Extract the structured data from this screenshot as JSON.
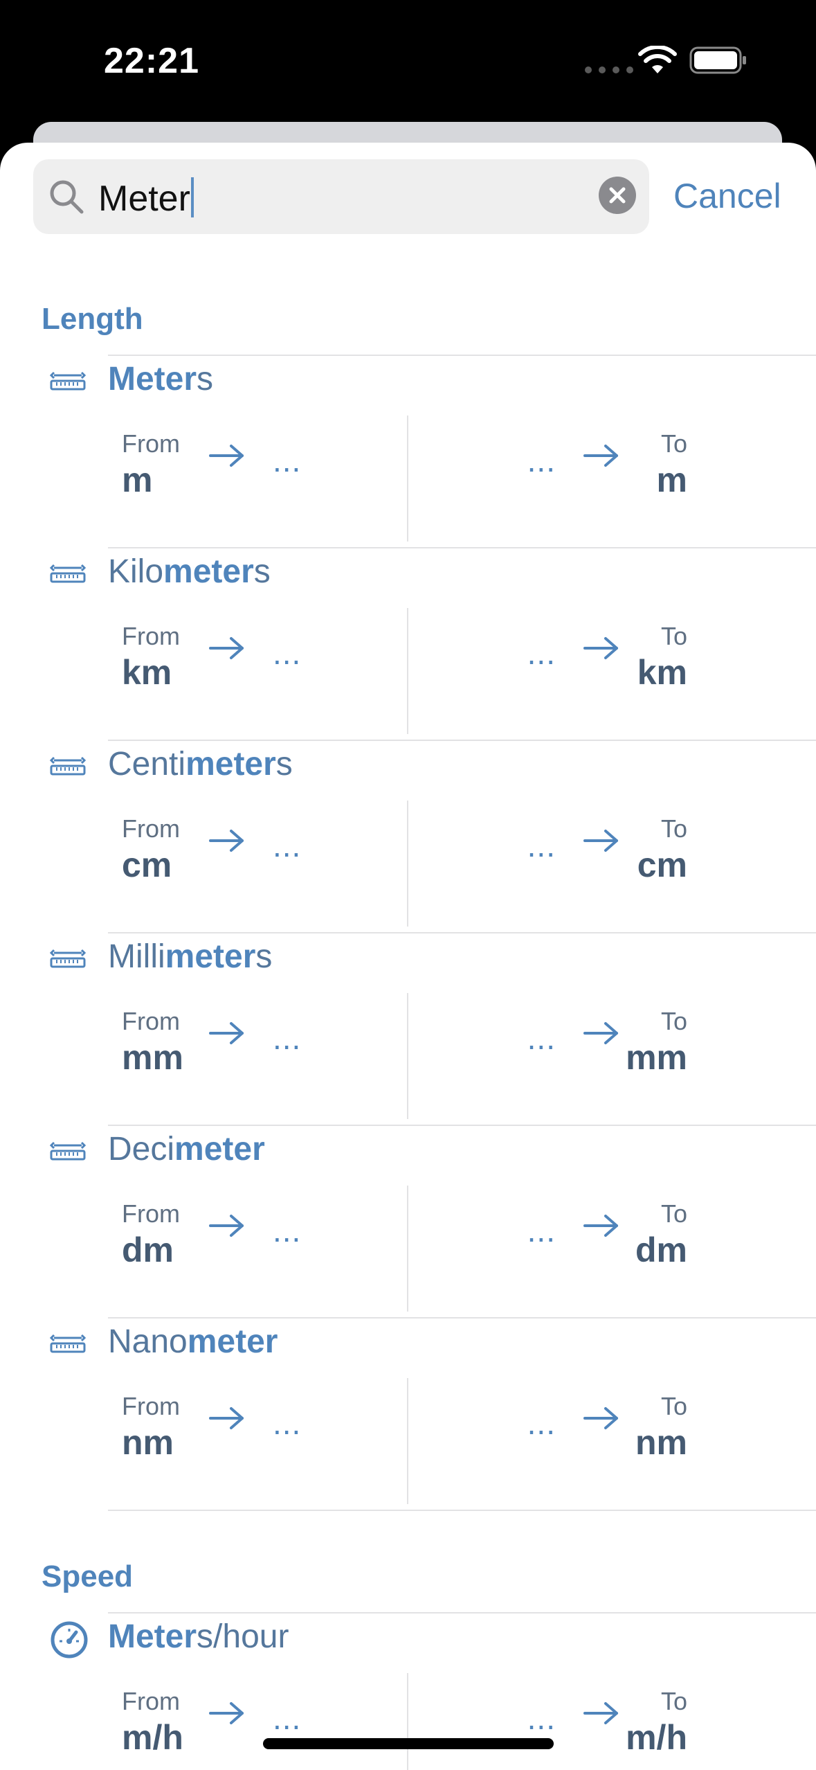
{
  "status_bar": {
    "time": "22:21"
  },
  "search": {
    "query": "Meter",
    "cancel_label": "Cancel"
  },
  "sections": [
    {
      "title": "Length",
      "units": [
        {
          "name_pre": "",
          "name_hl": "Meter",
          "name_post": "s",
          "from_label": "From",
          "from": "m",
          "to_label": "To",
          "to": "m",
          "ellipsis": "..."
        },
        {
          "name_pre": "Kilo",
          "name_hl": "meter",
          "name_post": "s",
          "from_label": "From",
          "from": "km",
          "to_label": "To",
          "to": "km",
          "ellipsis": "..."
        },
        {
          "name_pre": "Centi",
          "name_hl": "meter",
          "name_post": "s",
          "from_label": "From",
          "from": "cm",
          "to_label": "To",
          "to": "cm",
          "ellipsis": "..."
        },
        {
          "name_pre": "Milli",
          "name_hl": "meter",
          "name_post": "s",
          "from_label": "From",
          "from": "mm",
          "to_label": "To",
          "to": "mm",
          "ellipsis": "..."
        },
        {
          "name_pre": "Deci",
          "name_hl": "meter",
          "name_post": "",
          "from_label": "From",
          "from": "dm",
          "to_label": "To",
          "to": "dm",
          "ellipsis": "..."
        },
        {
          "name_pre": "Nano",
          "name_hl": "meter",
          "name_post": "",
          "from_label": "From",
          "from": "nm",
          "to_label": "To",
          "to": "nm",
          "ellipsis": "..."
        }
      ]
    },
    {
      "title": "Speed",
      "units": [
        {
          "name_pre": "",
          "name_hl": "Meter",
          "name_post": "s/hour",
          "from_label": "From",
          "from": "m/h",
          "to_label": "To",
          "to": "m/h",
          "ellipsis": "..."
        }
      ]
    }
  ],
  "colors": {
    "accent": "#4f84bb",
    "text_dark": "#455a72"
  },
  "icons": {
    "length": "ruler-icon",
    "speed": "speedometer-icon",
    "search": "search-icon",
    "clear": "clear-icon",
    "arrow": "arrow-right-icon"
  }
}
